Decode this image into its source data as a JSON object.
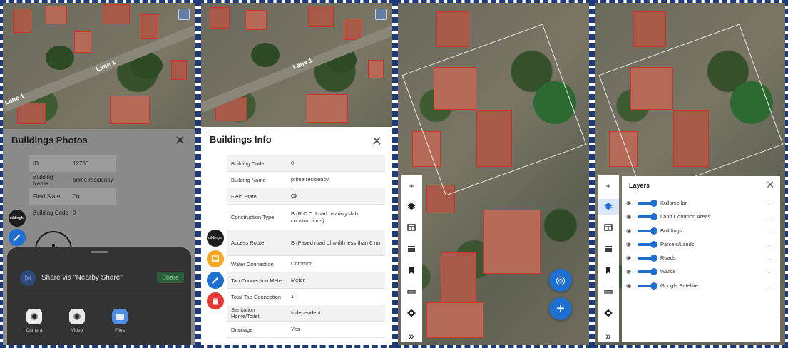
{
  "panel1": {
    "lane_label": "Lane 1",
    "sheet_title": "Buildings Photos",
    "close_glyph": "✕",
    "rows": [
      {
        "label": "ID",
        "value": "12706"
      },
      {
        "label": "Building Name",
        "value": "prime residency"
      },
      {
        "label": "Field State",
        "value": "Ok"
      },
      {
        "label": "Building Code",
        "value": "0"
      }
    ],
    "fab_dark_label": "uildingfe",
    "add_glyph": "+",
    "share": {
      "nearby_icon": "))((",
      "nearby_text": "Share via \"Nearby Share\"",
      "share_button": "Share",
      "apps": [
        {
          "name": "camera",
          "label": "Camera"
        },
        {
          "name": "video",
          "label": "Video"
        },
        {
          "name": "files",
          "label": "Files"
        }
      ]
    }
  },
  "panel2": {
    "lane_label": "Lane 1",
    "sheet_title": "Buildings Info",
    "close_glyph": "✕",
    "rows": [
      {
        "label": "Building Code",
        "value": "0"
      },
      {
        "label": "Building Name",
        "value": "prime residency"
      },
      {
        "label": "Field State",
        "value": "Ok"
      },
      {
        "label": "Construction Type",
        "value": "B (R.C.C. Load bearing slab constructions)"
      },
      {
        "label": "Access Route",
        "value": "B (Paved road of width less than 6 m)"
      },
      {
        "label": "Water Connection",
        "value": "Common"
      },
      {
        "label": "Tab Connection Meter",
        "value": "Meter"
      },
      {
        "label": "Total Tap Connection",
        "value": "1"
      },
      {
        "label": "Sanitation Home/Toilet",
        "value": "Independent"
      },
      {
        "label": "Drainage",
        "value": "Yes"
      }
    ],
    "fab_dark_label": "uildingfe"
  },
  "toolbar_icons": [
    "plus-icon",
    "layers-icon",
    "table-icon",
    "list-icon",
    "bookmark-icon",
    "ruler-icon",
    "gear-icon",
    "expand-icon"
  ],
  "toolbar_glyphs": {
    "plus": "+",
    "expand": "»"
  },
  "panel3": {
    "locate_glyph": "◎",
    "add_glyph": "+"
  },
  "panel4": {
    "layers_title": "Layers",
    "close_glyph": "✕",
    "layers": [
      {
        "name": "Kullanıcılar"
      },
      {
        "name": "Land Common Areas"
      },
      {
        "name": "Buildings"
      },
      {
        "name": "Parcels/Lands"
      },
      {
        "name": "Roads"
      },
      {
        "name": "Wards"
      },
      {
        "name": "Google Satellite"
      }
    ],
    "more_glyph": "..."
  },
  "colors": {
    "accent": "#1f6fd1",
    "building_outline": "#d3332c",
    "frame": "#1e3a78"
  }
}
